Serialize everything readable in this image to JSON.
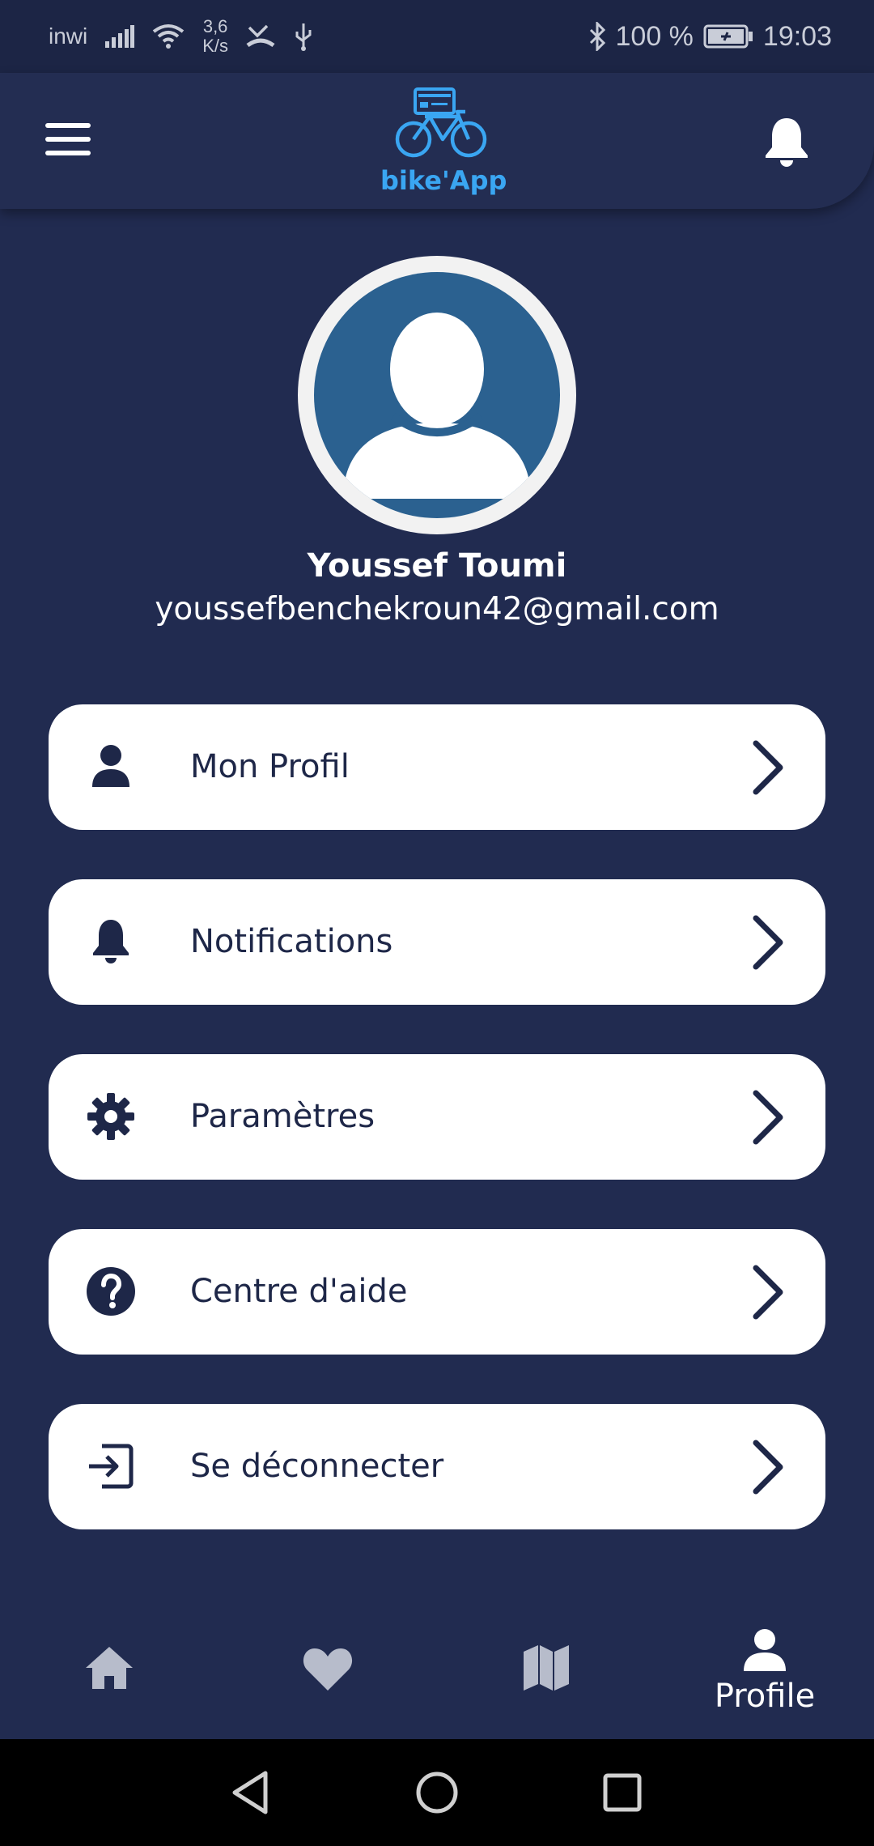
{
  "status_bar": {
    "carrier": "inwi",
    "speed_value": "3,6",
    "speed_unit": "K/s",
    "battery": "100 %",
    "time": "19:03"
  },
  "header": {
    "app_name": "bike'App",
    "logo_color": "#3aa6f2"
  },
  "profile": {
    "name": "Youssef Toumi",
    "email": "youssefbenchekroun42@gmail.com",
    "avatar_colors": {
      "ring": "#f2f2f2",
      "bg": "#2b6190",
      "figure": "#ffffff"
    }
  },
  "menu": [
    {
      "label": "Mon Profil",
      "icon": "person-icon"
    },
    {
      "label": "Notifications",
      "icon": "bell-icon"
    },
    {
      "label": "Paramètres",
      "icon": "gear-icon"
    },
    {
      "label": "Centre d'aide",
      "icon": "help-icon"
    },
    {
      "label": "Se déconnecter",
      "icon": "logout-icon"
    }
  ],
  "bottom_nav": {
    "items": [
      {
        "icon": "home-icon",
        "active": false
      },
      {
        "icon": "heart-icon",
        "active": false
      },
      {
        "icon": "map-icon",
        "active": false
      },
      {
        "icon": "person-icon",
        "label": "Profile",
        "active": true
      }
    ],
    "active_color": "#ffffff",
    "inactive_color": "#b7bccb"
  },
  "colors": {
    "background": "#212b50",
    "header": "#232d52",
    "card": "#ffffff",
    "card_text": "#1e2748"
  }
}
